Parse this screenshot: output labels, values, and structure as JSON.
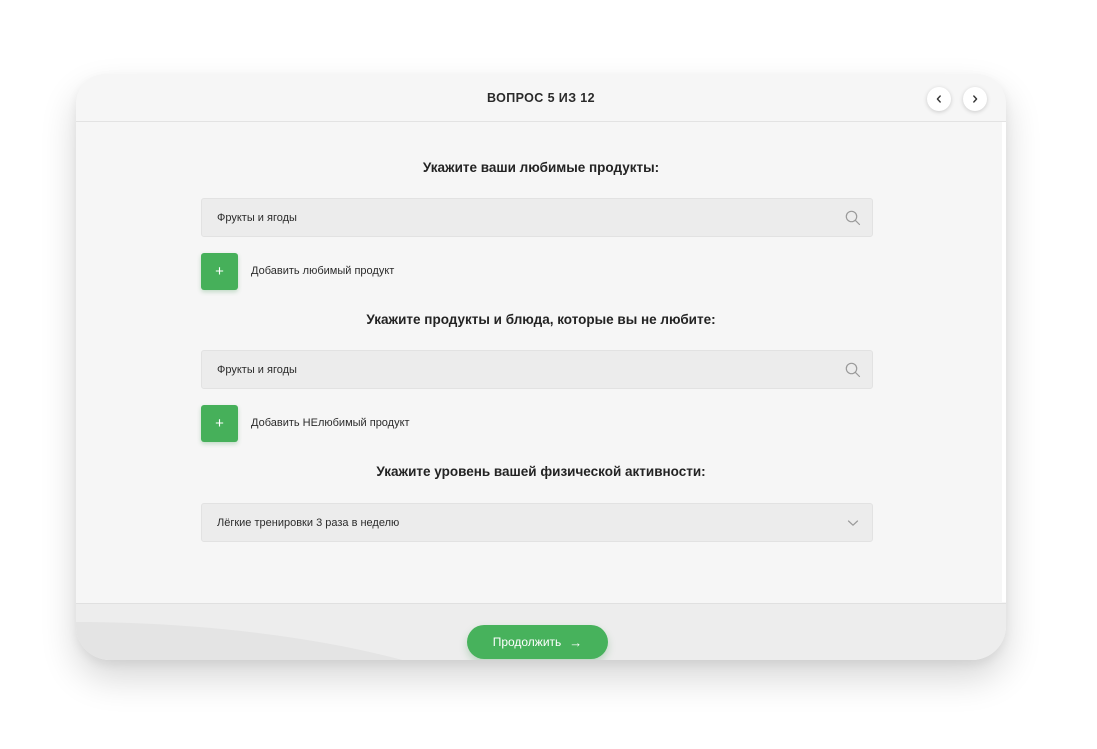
{
  "header": {
    "title": "ВОПРОС 5 ИЗ 12",
    "prev_icon": "chevron-left-icon",
    "next_icon": "chevron-right-icon"
  },
  "sections": {
    "favorite": {
      "title": "Укажите ваши любимые продукты:",
      "field_value": "Фрукты и ягоды",
      "field_icon": "search-icon",
      "add_label": "Добавить любимый продукт",
      "add_symbol": "+"
    },
    "disliked": {
      "title": "Укажите продукты и блюда, которые вы не любите:",
      "field_value": "Фрукты и ягоды",
      "field_icon": "search-icon",
      "add_label": "Добавить НЕлюбимый продукт",
      "add_symbol": "+"
    },
    "activity": {
      "title": "Укажите уровень вашей физической активности:",
      "selected": "Лёгкие тренировки 3 раза в неделю",
      "field_icon": "chevron-down-icon"
    }
  },
  "footer": {
    "continue_label": "Продолжить",
    "continue_arrow": "→"
  },
  "colors": {
    "accent": "#47b25c",
    "card_bg": "#f6f6f6",
    "field_bg": "#ececec"
  }
}
